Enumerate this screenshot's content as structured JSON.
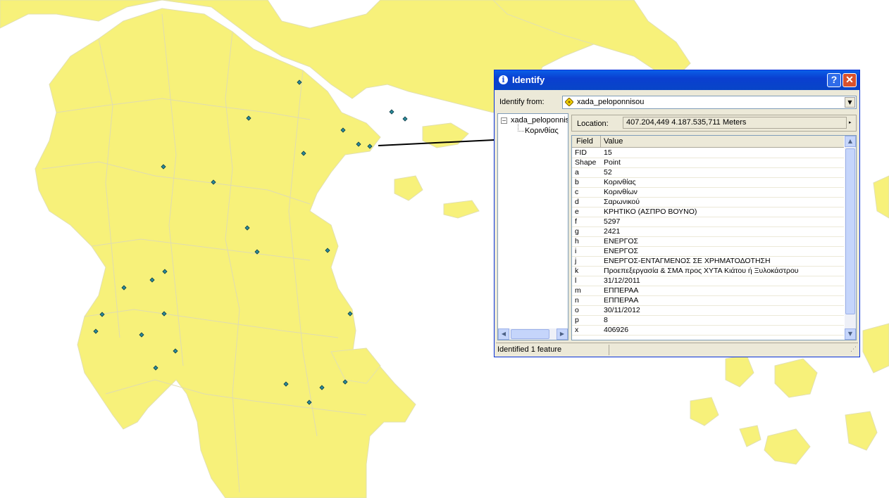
{
  "map": {
    "land_color": "#f7f17a",
    "border_color": "#dcdcdc",
    "point_color": "#2a8a9a"
  },
  "dialog": {
    "title": "Identify",
    "help_label": "?",
    "close_label": "✕",
    "identify_from_label": "Identify from:",
    "identify_from_value": "xada_peloponnisou",
    "tree_root": "xada_peloponnisou",
    "tree_child": "Κορινθίας",
    "location_label": "Location:",
    "location_value": "407.204,449  4.187.535,711 Meters",
    "columns": [
      "Field",
      "Value"
    ],
    "rows": [
      {
        "field": "FID",
        "value": "15"
      },
      {
        "field": "Shape",
        "value": "Point"
      },
      {
        "field": "a",
        "value": "52"
      },
      {
        "field": "b",
        "value": "Κορινθίας"
      },
      {
        "field": "c",
        "value": "Κορινθίων"
      },
      {
        "field": "d",
        "value": "Σαρωνικού"
      },
      {
        "field": "e",
        "value": "ΚΡΗΤΙΚΟ (ΑΣΠΡΟ ΒΟΥΝΟ)"
      },
      {
        "field": "f",
        "value": "5297"
      },
      {
        "field": "g",
        "value": "2421"
      },
      {
        "field": "h",
        "value": "ΕΝΕΡΓΟΣ"
      },
      {
        "field": "i",
        "value": "ΕΝΕΡΓΟΣ"
      },
      {
        "field": "j",
        "value": "ΕΝΕΡΓΟΣ-ΕΝΤΑΓΜΕΝΟΣ ΣΕ ΧΡΗΜΑΤΟΔΟΤΗΣΗ"
      },
      {
        "field": "k",
        "value": "Προεπεξεργασία & ΣΜΑ προς ΧΥΤΑ Κιάτου ή Ξυλοκάστρου"
      },
      {
        "field": "l",
        "value": "31/12/2011"
      },
      {
        "field": "m",
        "value": "ΕΠΠΕΡΑΑ"
      },
      {
        "field": "n",
        "value": "ΕΠΠΕΡΑΑ"
      },
      {
        "field": "o",
        "value": "30/11/2012"
      },
      {
        "field": "p",
        "value": "8"
      },
      {
        "field": "x",
        "value": "406926"
      }
    ],
    "status_text": "Identified 1 feature"
  }
}
